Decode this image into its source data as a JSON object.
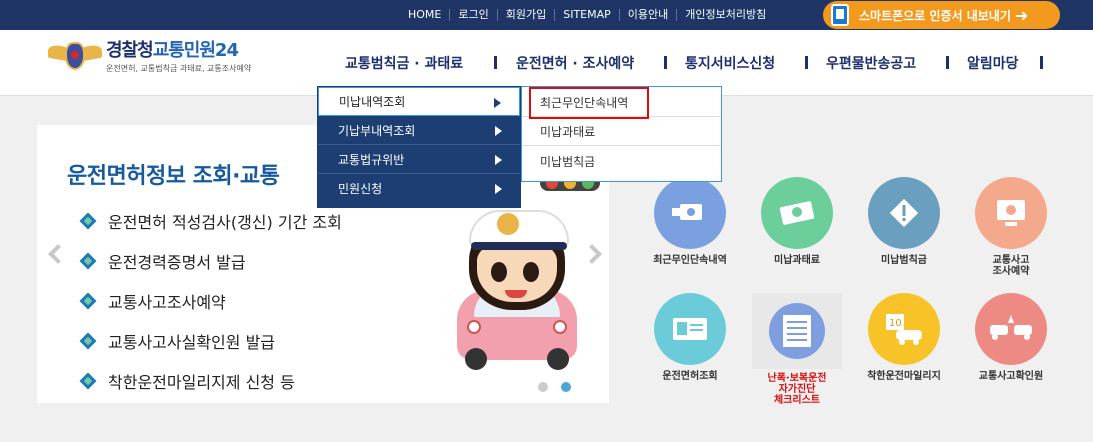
{
  "util_nav": [
    "HOME",
    "로그인",
    "회원가입",
    "SITEMAP",
    "이용안내",
    "개인정보처리방침"
  ],
  "smart_button": {
    "label": "스마트폰으로 인증서 내보내기",
    "icon": "phone-icon"
  },
  "logo": {
    "title_part1": "경찰청",
    "title_part2": "교통민원24",
    "subtitle": "운전면허, 교통범칙금 과태료, 교통조사예약",
    "emblem": "police-emblem-icon"
  },
  "gnb": [
    "교통범칙금 · 과태료",
    "운전면허 · 조사예약",
    "통지서비스신청",
    "우편물반송공고",
    "알림마당"
  ],
  "dropdown": {
    "level1": [
      "미납내역조회",
      "기납부내역조회",
      "교통법규위반",
      "민원신청"
    ],
    "level2": [
      "최근무인단속내역",
      "미납과태료",
      "미납범칙금"
    ]
  },
  "slide": {
    "title": "운전면허정보 조회·교통",
    "bullets": [
      "운전면허 적성검사(갱신) 기간 조회",
      "운전경력증명서 발급",
      "교통사고조사예약",
      "교통사고사실확인원 발급",
      "착한운전마일리지제 신청 등"
    ]
  },
  "services": [
    {
      "label": "최근무인단속내역",
      "icon": "camera-icon",
      "color": "#7aa0e0"
    },
    {
      "label": "미납과태료",
      "icon": "money-icon",
      "color": "#6ccf9b"
    },
    {
      "label": "미납범칙금",
      "icon": "warning-icon",
      "color": "#6b9fbf"
    },
    {
      "label": "교통사고\n조사예약",
      "icon": "monitor-icon",
      "color": "#f4a98c"
    },
    {
      "label": "운전면허조회",
      "icon": "license-icon",
      "color": "#6ccbd8"
    },
    {
      "label": "난폭·보복운전\n자가진단\n체크리스트",
      "icon": "checklist-icon",
      "color": "#7f9ee0"
    },
    {
      "label": "착한운전마일리지",
      "icon": "mileage-car-icon",
      "color": "#f8c328"
    },
    {
      "label": "교통사고확인원",
      "icon": "crash-icon",
      "color": "#ec8a83"
    }
  ],
  "colors": {
    "topbar": "#1e3566",
    "accent_orange": "#f39a1e",
    "menu_blue": "#1d3e73",
    "highlight_red": "#d90d0d"
  }
}
